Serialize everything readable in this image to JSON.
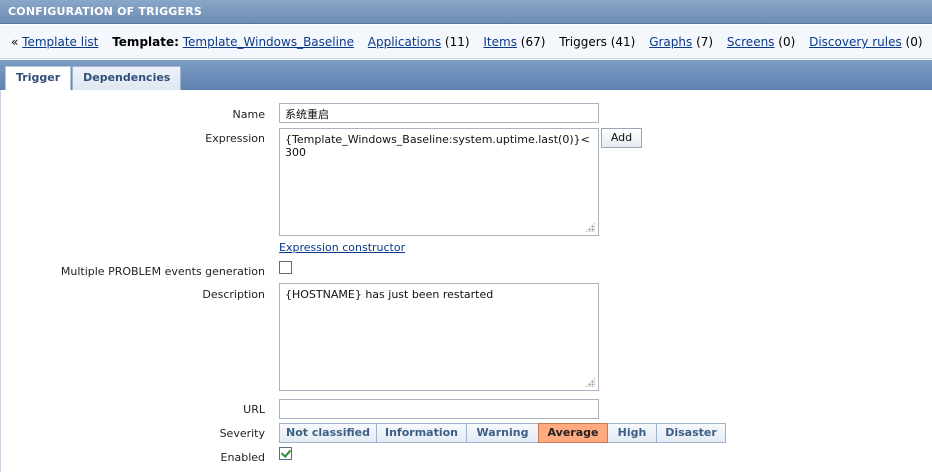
{
  "header": {
    "title": "CONFIGURATION OF TRIGGERS"
  },
  "nav": {
    "back_arrow": "«",
    "template_list": "Template list",
    "template_label": "Template:",
    "template_name": "Template_Windows_Baseline",
    "applications": "Applications",
    "applications_count": "(11)",
    "items": "Items",
    "items_count": "(67)",
    "triggers": "Triggers",
    "triggers_count": "(41)",
    "graphs": "Graphs",
    "graphs_count": "(7)",
    "screens": "Screens",
    "screens_count": "(0)",
    "discovery": "Discovery rules",
    "discovery_count": "(0)"
  },
  "tabs": [
    {
      "label": "Trigger",
      "active": true
    },
    {
      "label": "Dependencies",
      "active": false
    }
  ],
  "form": {
    "name_label": "Name",
    "name_value": "系统重启",
    "expression_label": "Expression",
    "expression_value": "{Template_Windows_Baseline:system.uptime.last(0)}<300",
    "add_button": "Add",
    "expression_constructor": "Expression constructor",
    "multiple_label": "Multiple PROBLEM events generation",
    "multiple_checked": false,
    "description_label": "Description",
    "description_value": "{HOSTNAME} has just been restarted",
    "url_label": "URL",
    "url_value": "",
    "severity_label": "Severity",
    "severity_options": [
      "Not classified",
      "Information",
      "Warning",
      "Average",
      "High",
      "Disaster"
    ],
    "severity_selected": "Average",
    "enabled_label": "Enabled",
    "enabled_checked": true
  },
  "colors": {
    "severity_selected": "#ffaa80",
    "header": "#7d9cc4",
    "link": "#0a3a8c"
  }
}
